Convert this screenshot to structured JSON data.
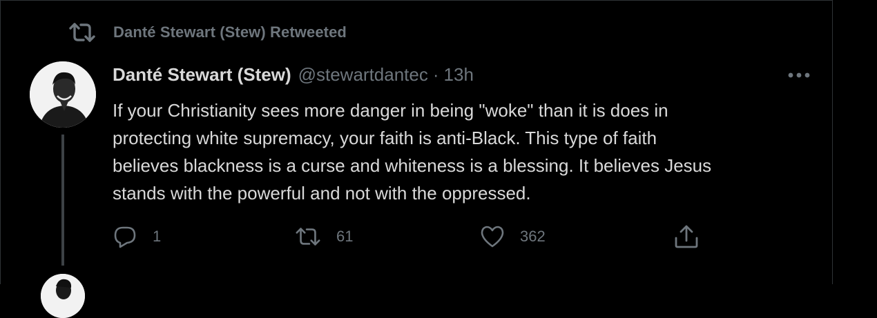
{
  "retweet_banner": {
    "icon": "retweet-icon",
    "label": "Danté Stewart (Stew) Retweeted"
  },
  "tweet": {
    "avatar": "avatar-photo",
    "author_name": "Danté Stewart (Stew)",
    "handle": "@stewartdantec",
    "separator": "·",
    "time": "13h",
    "text_lines": [
      "If your Christianity sees more danger in being \"woke\" than it is does in",
      "protecting white supremacy, your faith is anti-Black. This type of faith",
      "believes blackness is a curse and whiteness is a blessing. It believes Jesus",
      "stands with the powerful and not with the oppressed."
    ],
    "actions": {
      "reply": {
        "icon": "reply-icon",
        "count": "1"
      },
      "retweet": {
        "icon": "retweet-icon",
        "count": "61"
      },
      "like": {
        "icon": "heart-icon",
        "count": "362"
      },
      "share": {
        "icon": "share-icon"
      }
    },
    "more_icon": "more-icon"
  },
  "colors": {
    "background": "#000000",
    "primary_text": "#d9d9d9",
    "secondary_text": "#6e767d",
    "border": "#2f3336"
  }
}
